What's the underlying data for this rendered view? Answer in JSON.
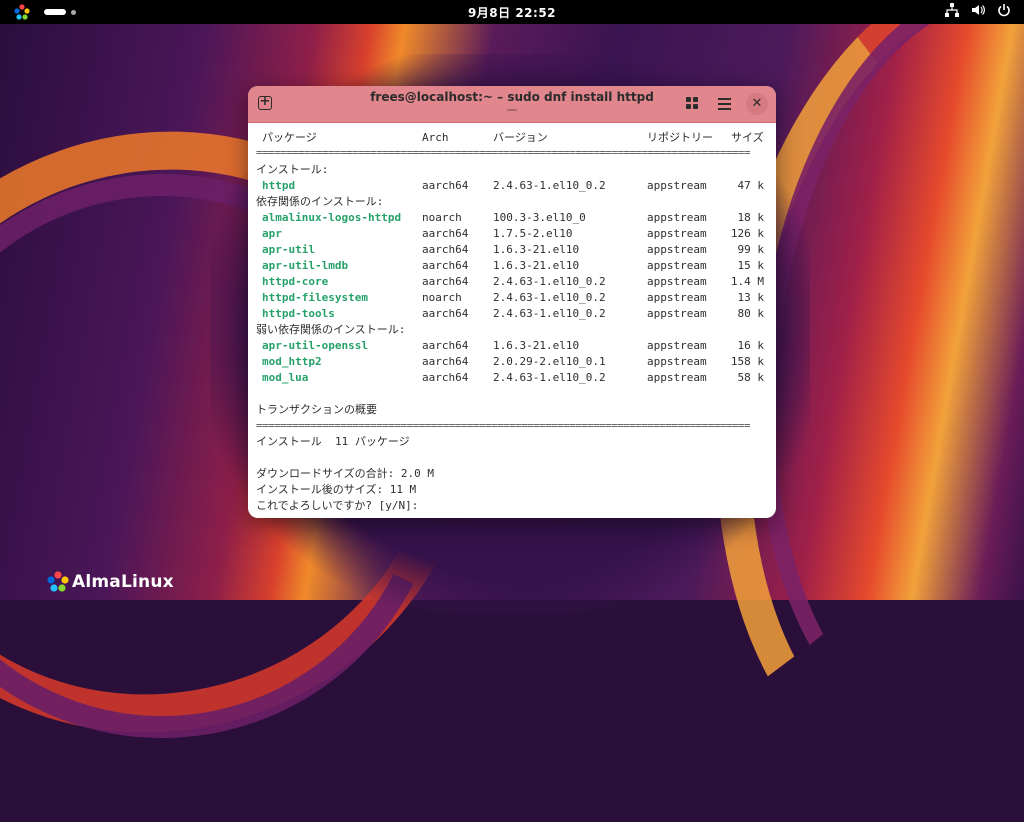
{
  "topbar": {
    "clock": "9月8日  22:52"
  },
  "window": {
    "title": "frees@localhost:~ – sudo dnf install httpd"
  },
  "terminal": {
    "header": {
      "pkg": "パッケージ",
      "arch": "Arch",
      "version": "バージョン",
      "repo": "リポジトリー",
      "size": "サイズ"
    },
    "separator": "==================================================================================",
    "install_heading": "インストール:",
    "install": [
      {
        "name": "httpd",
        "arch": "aarch64",
        "version": "2.4.63-1.el10_0.2",
        "repo": "appstream",
        "size": "47 k"
      }
    ],
    "deps_heading": "依存関係のインストール:",
    "deps": [
      {
        "name": "almalinux-logos-httpd",
        "arch": "noarch",
        "version": "100.3-3.el10_0",
        "repo": "appstream",
        "size": "18 k"
      },
      {
        "name": "apr",
        "arch": "aarch64",
        "version": "1.7.5-2.el10",
        "repo": "appstream",
        "size": "126 k"
      },
      {
        "name": "apr-util",
        "arch": "aarch64",
        "version": "1.6.3-21.el10",
        "repo": "appstream",
        "size": "99 k"
      },
      {
        "name": "apr-util-lmdb",
        "arch": "aarch64",
        "version": "1.6.3-21.el10",
        "repo": "appstream",
        "size": "15 k"
      },
      {
        "name": "httpd-core",
        "arch": "aarch64",
        "version": "2.4.63-1.el10_0.2",
        "repo": "appstream",
        "size": "1.4 M"
      },
      {
        "name": "httpd-filesystem",
        "arch": "noarch",
        "version": "2.4.63-1.el10_0.2",
        "repo": "appstream",
        "size": "13 k"
      },
      {
        "name": "httpd-tools",
        "arch": "aarch64",
        "version": "2.4.63-1.el10_0.2",
        "repo": "appstream",
        "size": "80 k"
      }
    ],
    "weak_heading": "弱い依存関係のインストール:",
    "weak": [
      {
        "name": "apr-util-openssl",
        "arch": "aarch64",
        "version": "1.6.3-21.el10",
        "repo": "appstream",
        "size": "16 k"
      },
      {
        "name": "mod_http2",
        "arch": "aarch64",
        "version": "2.0.29-2.el10_0.1",
        "repo": "appstream",
        "size": "158 k"
      },
      {
        "name": "mod_lua",
        "arch": "aarch64",
        "version": "2.4.63-1.el10_0.2",
        "repo": "appstream",
        "size": "58 k"
      }
    ],
    "summary_heading": "トランザクションの概要",
    "summary_install": "インストール  11 パッケージ",
    "download_size": "ダウンロードサイズの合計: 2.0 M",
    "installed_size": "インストール後のサイズ: 11 M",
    "prompt": "これでよろしいですか? [y/N]:"
  },
  "branding": {
    "logo_text": "AlmaLinux"
  }
}
